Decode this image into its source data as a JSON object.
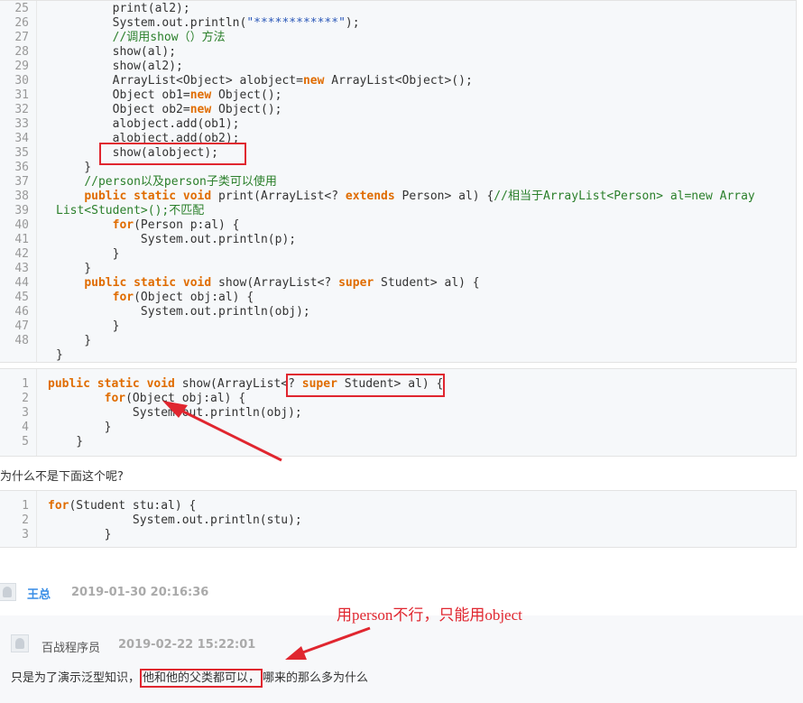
{
  "code1": {
    "lines": [
      {
        "n": "25",
        "code": [
          {
            "t": "        print(al2);"
          }
        ]
      },
      {
        "n": "26",
        "code": [
          {
            "t": "        System.out.println("
          },
          {
            "t": "\"************\"",
            "c": "st"
          },
          {
            "t": ");"
          }
        ]
      },
      {
        "n": "27",
        "code": [
          {
            "t": "        "
          },
          {
            "t": "//调用show（）方法",
            "c": "cm"
          }
        ]
      },
      {
        "n": "28",
        "code": [
          {
            "t": "        show(al);"
          }
        ]
      },
      {
        "n": "29",
        "code": [
          {
            "t": "        show(al2);"
          }
        ]
      },
      {
        "n": "30",
        "code": [
          {
            "t": "        ArrayList<Object> alobject="
          },
          {
            "t": "new",
            "c": "kw"
          },
          {
            "t": " ArrayList<Object>();"
          }
        ]
      },
      {
        "n": "31",
        "code": [
          {
            "t": "        Object ob1="
          },
          {
            "t": "new",
            "c": "kw"
          },
          {
            "t": " Object();"
          }
        ]
      },
      {
        "n": "32",
        "code": [
          {
            "t": "        Object ob2="
          },
          {
            "t": "new",
            "c": "kw"
          },
          {
            "t": " Object();"
          }
        ]
      },
      {
        "n": "33",
        "code": [
          {
            "t": "        alobject.add(ob1);"
          }
        ]
      },
      {
        "n": "34",
        "code": [
          {
            "t": "        alobject.add(ob2);"
          }
        ]
      },
      {
        "n": "35",
        "code": [
          {
            "t": "        show(alobject);"
          }
        ]
      },
      {
        "n": "36",
        "code": [
          {
            "t": "    }"
          }
        ]
      },
      {
        "n": "37",
        "code": [
          {
            "t": "    "
          },
          {
            "t": "//person以及person子类可以使用",
            "c": "cm"
          }
        ]
      },
      {
        "n": "38",
        "code": [
          {
            "t": "    "
          },
          {
            "t": "public static void",
            "c": "kw"
          },
          {
            "t": " print(ArrayList<? "
          },
          {
            "t": "extends",
            "c": "kw"
          },
          {
            "t": " Person> al) {"
          },
          {
            "t": "//相当于ArrayList<Person> al=new Array",
            "c": "cm"
          }
        ]
      },
      {
        "n": "39",
        "code": [
          {
            "t": "List<Student>();不匹配",
            "c": "cm"
          }
        ]
      },
      {
        "n": "40",
        "code": [
          {
            "t": "        "
          },
          {
            "t": "for",
            "c": "kw"
          },
          {
            "t": "(Person p:al) {"
          }
        ]
      },
      {
        "n": "41",
        "code": [
          {
            "t": "            System.out.println(p);"
          }
        ]
      },
      {
        "n": "42",
        "code": [
          {
            "t": "        }"
          }
        ]
      },
      {
        "n": "43",
        "code": [
          {
            "t": "    }"
          }
        ]
      },
      {
        "n": "44",
        "code": [
          {
            "t": "    "
          },
          {
            "t": "public static void",
            "c": "kw"
          },
          {
            "t": " show(ArrayList<? "
          },
          {
            "t": "super",
            "c": "kw"
          },
          {
            "t": " Student> al) {"
          }
        ]
      },
      {
        "n": "45",
        "code": [
          {
            "t": "        "
          },
          {
            "t": "for",
            "c": "kw"
          },
          {
            "t": "(Object obj:al) {"
          }
        ]
      },
      {
        "n": "46",
        "code": [
          {
            "t": "            System.out.println(obj);"
          }
        ]
      },
      {
        "n": "47",
        "code": [
          {
            "t": "        }"
          }
        ]
      },
      {
        "n": "48",
        "code": [
          {
            "t": "    }"
          }
        ]
      },
      {
        "n": "",
        "code": [
          {
            "t": "}"
          }
        ]
      }
    ]
  },
  "code2": {
    "lines": [
      {
        "n": "1",
        "code": [
          {
            "t": "public static void",
            "c": "kw"
          },
          {
            "t": " show(ArrayList<? "
          },
          {
            "t": "super",
            "c": "kw"
          },
          {
            "t": " Student> al) {"
          }
        ]
      },
      {
        "n": "2",
        "code": [
          {
            "t": "        "
          },
          {
            "t": "for",
            "c": "kw"
          },
          {
            "t": "(Object obj:al) {"
          }
        ]
      },
      {
        "n": "3",
        "code": [
          {
            "t": "            System.out.println(obj);"
          }
        ]
      },
      {
        "n": "4",
        "code": [
          {
            "t": "        }"
          }
        ]
      },
      {
        "n": "5",
        "code": [
          {
            "t": "    }"
          }
        ]
      }
    ]
  },
  "question": "为什么不是下面这个呢?",
  "code3": {
    "lines": [
      {
        "n": "1",
        "code": [
          {
            "t": "for",
            "c": "kw"
          },
          {
            "t": "(Student stu:al) {"
          }
        ]
      },
      {
        "n": "2",
        "code": [
          {
            "t": "            System.out.println(stu);"
          }
        ]
      },
      {
        "n": "3",
        "code": [
          {
            "t": "        }"
          }
        ]
      }
    ]
  },
  "comment": {
    "author": "王总",
    "time": "2019-01-30 20:16:36"
  },
  "reply": {
    "author": "百战程序员",
    "time": "2019-02-22 15:22:01",
    "text_before": "只是为了演示泛型知识，",
    "text_highlight": "他和他的父类都可以，",
    "text_after": "哪来的那么多为什么"
  },
  "annotation": "用person不行，只能用object",
  "colors": {
    "keyword": "#e06c00",
    "comment": "#2a7f2a",
    "string": "#2b58b8",
    "highlight_box": "#e0262f",
    "author_link": "#3a8ee6"
  }
}
